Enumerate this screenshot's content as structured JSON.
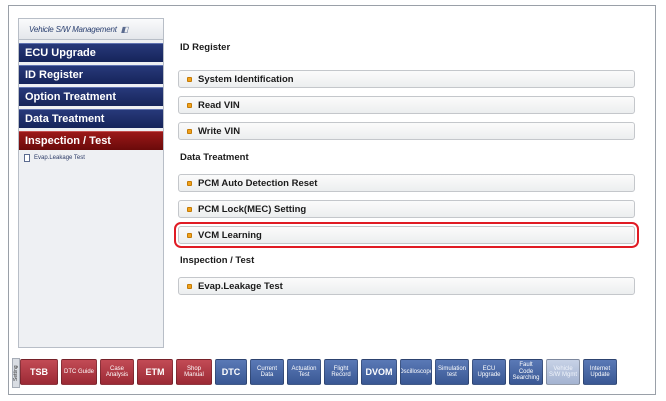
{
  "sidebar": {
    "header": "Vehicle S/W Management",
    "items": [
      {
        "label": "ECU Upgrade"
      },
      {
        "label": "ID Register"
      },
      {
        "label": "Option Treatment"
      },
      {
        "label": "Data Treatment"
      },
      {
        "label": "Inspection / Test"
      }
    ],
    "sub_item": "Evap.Leakage Test"
  },
  "main": {
    "sections": [
      {
        "title": "ID Register",
        "rows": [
          "System Identification",
          "Read VIN",
          "Write VIN"
        ]
      },
      {
        "title": "Data Treatment",
        "rows": [
          "PCM Auto Detection Reset",
          "PCM Lock(MEC) Setting",
          "VCM Learning"
        ]
      },
      {
        "title": "Inspection / Test",
        "rows": [
          "Evap.Leakage Test"
        ]
      }
    ],
    "highlighted_row": "VCM Learning"
  },
  "toolbar": {
    "setting_label": "Setting",
    "buttons": [
      {
        "label": "TSB",
        "color": "red"
      },
      {
        "label": "DTC Guide",
        "color": "red"
      },
      {
        "label": "Case Analysis",
        "color": "red"
      },
      {
        "label": "ETM",
        "color": "red"
      },
      {
        "label": "Shop Manual",
        "color": "red"
      },
      {
        "label": "DTC",
        "color": "blue"
      },
      {
        "label": "Current Data",
        "color": "blue"
      },
      {
        "label": "Actuation Test",
        "color": "blue"
      },
      {
        "label": "Flight Record",
        "color": "blue"
      },
      {
        "label": "DVOM",
        "color": "blue"
      },
      {
        "label": "Oscilloscope",
        "color": "blue"
      },
      {
        "label": "Simulation test",
        "color": "blue"
      },
      {
        "label": "ECU Upgrade",
        "color": "blue"
      },
      {
        "label": "Fault Code Searching",
        "color": "blue"
      },
      {
        "label": "Vehicle S/W Mgmt",
        "color": "light"
      },
      {
        "label": "Internet Update",
        "color": "blue"
      }
    ]
  },
  "colors": {
    "sidebar_item": "#1f2f6b",
    "sidebar_active": "#8a1212",
    "highlight_outline": "#e01b24",
    "bullet": "#f1a21b"
  }
}
